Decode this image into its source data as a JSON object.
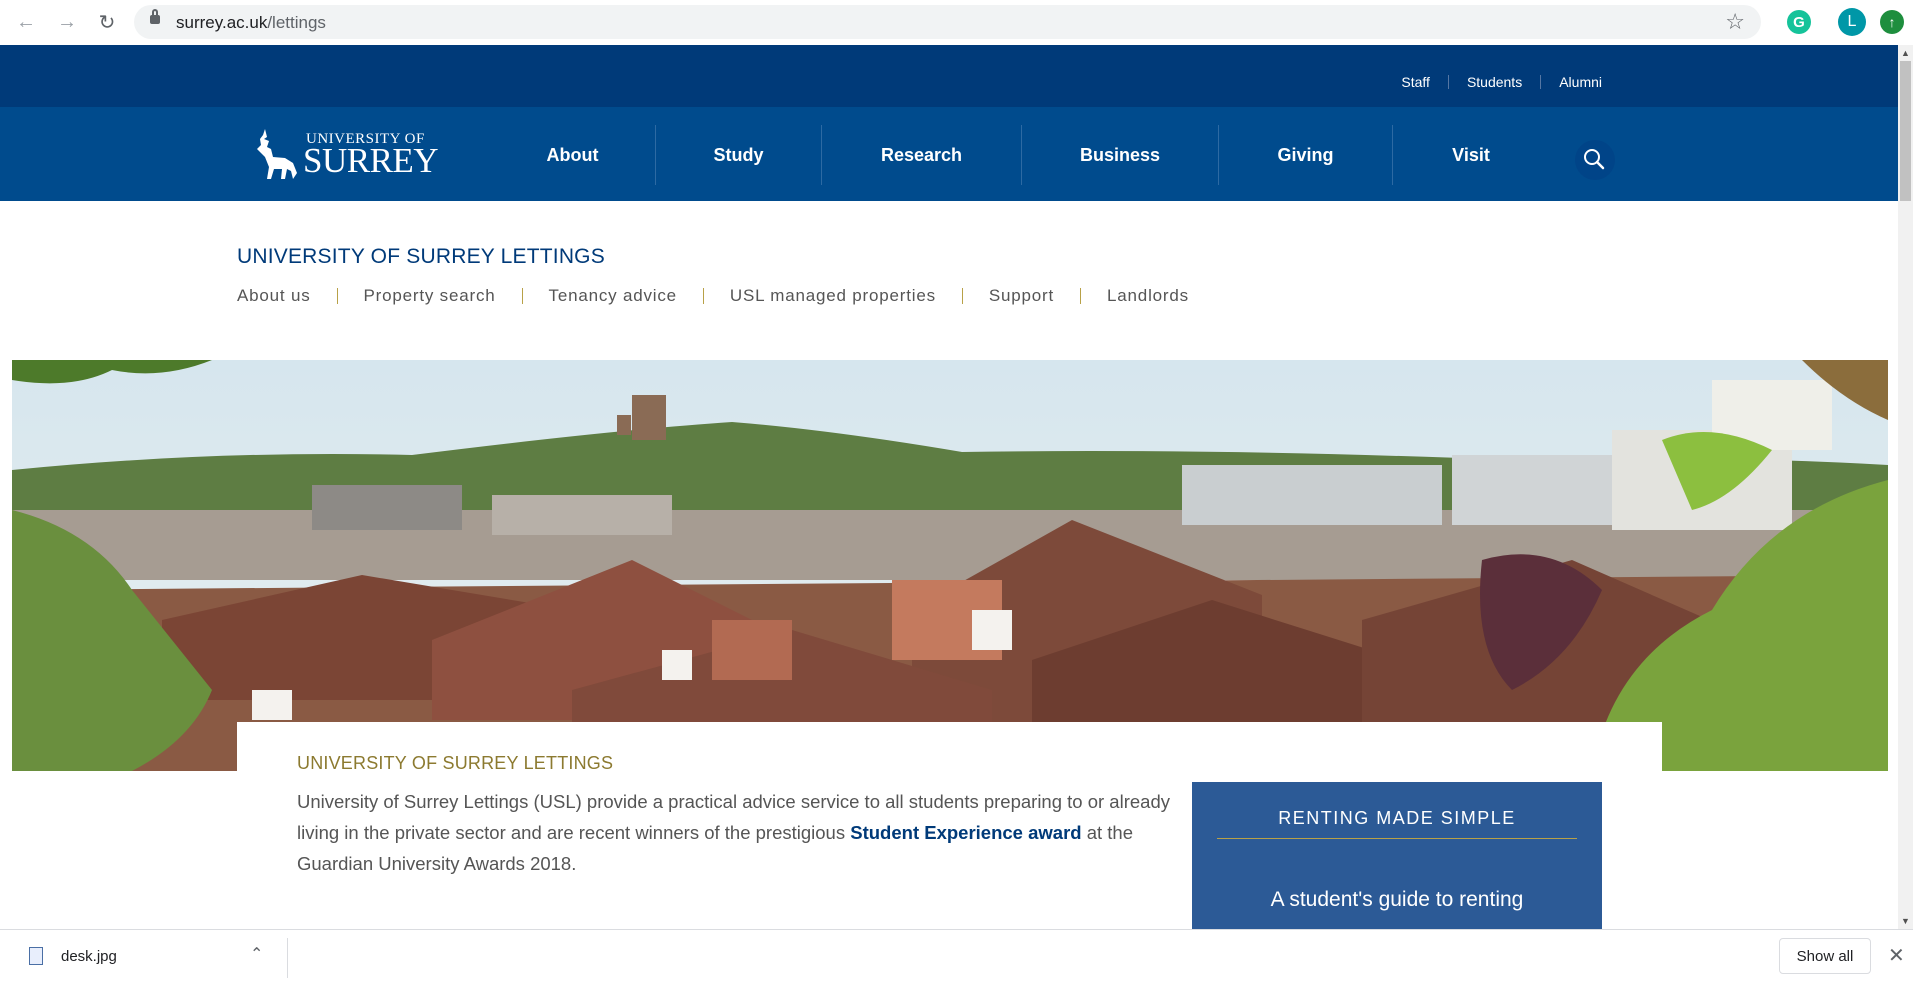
{
  "browser": {
    "url_domain": "surrey.ac.uk",
    "url_path": "/lettings",
    "profile_initial": "L",
    "extension_initial": "G"
  },
  "utility_nav": [
    "Staff",
    "Students",
    "Alumni"
  ],
  "logo": {
    "line1": "UNIVERSITY OF",
    "line2": "SURREY"
  },
  "main_nav": [
    "About",
    "Study",
    "Research",
    "Business",
    "Giving",
    "Visit"
  ],
  "section": {
    "title": "UNIVERSITY OF SURREY LETTINGS",
    "subnav": [
      "About us",
      "Property search",
      "Tenancy advice",
      "USL managed properties",
      "Support",
      "Landlords"
    ]
  },
  "content": {
    "heading": "UNIVERSITY OF SURREY LETTINGS",
    "para_before": "University of Surrey Lettings (USL) provide a practical advice service to all students preparing to or already living in the private sector and are recent winners of the prestigious ",
    "para_link": "Student Experience award",
    "para_after": " at the Guardian University Awards 2018.",
    "promo_title": "RENTING MADE SIMPLE",
    "promo_subtitle": "A student's guide to renting"
  },
  "downloads": {
    "filename": "desk.jpg",
    "show_all": "Show all"
  },
  "colors": {
    "utility_bg": "#003a79",
    "nav_bg": "#004b8d",
    "accent_gold": "#b8a148",
    "promo_bg": "#2c5a96"
  }
}
